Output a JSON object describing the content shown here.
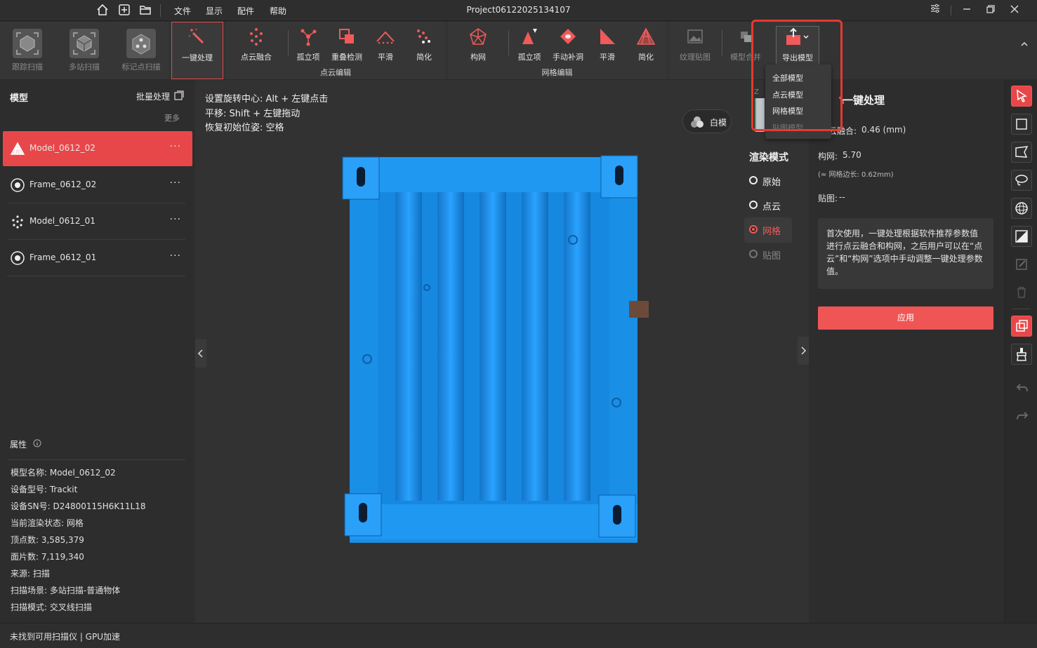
{
  "titlebar": {
    "menus": [
      "文件",
      "显示",
      "配件",
      "帮助"
    ],
    "project_title": "Project06122025134107"
  },
  "ribbon": {
    "scan": [
      "跟踪扫描",
      "多站扫描",
      "标记点扫描"
    ],
    "one_click": "一键处理",
    "pointcloud_items": [
      "点云融合",
      "孤立项",
      "重叠检测",
      "平滑",
      "简化"
    ],
    "pointcloud_group": "点云编辑",
    "mesh_items": [
      "构网",
      "孤立项",
      "手动补洞",
      "平滑",
      "简化"
    ],
    "mesh_group": "网格编辑",
    "texture_map": "纹理贴图",
    "model_merge": "模型合并",
    "export_model": "导出模型",
    "export_menu": [
      "全部模型",
      "点云模型",
      "网格模型",
      "贴图模型"
    ]
  },
  "left_panel": {
    "title": "模型",
    "batch": "批量处理",
    "more": "更多",
    "models": [
      "Model_0612_02",
      "Frame_0612_02",
      "Model_0612_01",
      "Frame_0612_01"
    ],
    "more_icon": "···",
    "properties_title": "属性",
    "properties": [
      "模型名称: Model_0612_02",
      "设备型号: Trackit",
      "设备SN号: D24800115H6K11L18",
      "当前渲染状态: 网格",
      "顶点数: 3,585,379",
      "面片数: 7,119,340",
      "来源: 扫描",
      "扫描场景: 多站扫描-普通物体",
      "扫描模式: 交叉线扫描"
    ]
  },
  "viewport": {
    "hints": [
      "设置旋转中心: Alt + 左键点击",
      "平移: Shift + 左键拖动",
      "恢复初始位姿: 空格"
    ],
    "white_model": "白模",
    "render_mode_title": "渲染模式",
    "render_modes": [
      "原始",
      "点云",
      "网格",
      "贴图"
    ],
    "selected_render_mode": "网格",
    "axis_z": "Z",
    "accent": "#e8474a",
    "model_color": "#1a8fe6"
  },
  "right_panel": {
    "title": "一键处理",
    "fusion_label": "云融合:",
    "fusion_value": "0.46 (mm)",
    "mesh_label": "构网:",
    "mesh_value": "5.70",
    "mesh_note": "(≈ 网格边长: 0.62mm)",
    "texture_label": "贴图:",
    "texture_value": "--",
    "info": "首次使用，一键处理根据软件推荐参数值进行点云融合和构网，之后用户可以在“点云”和“构网”选项中手动调整一键处理参数值。",
    "apply": "应用"
  },
  "statusbar": {
    "text": "未找到可用扫描仪 | GPU加速"
  }
}
